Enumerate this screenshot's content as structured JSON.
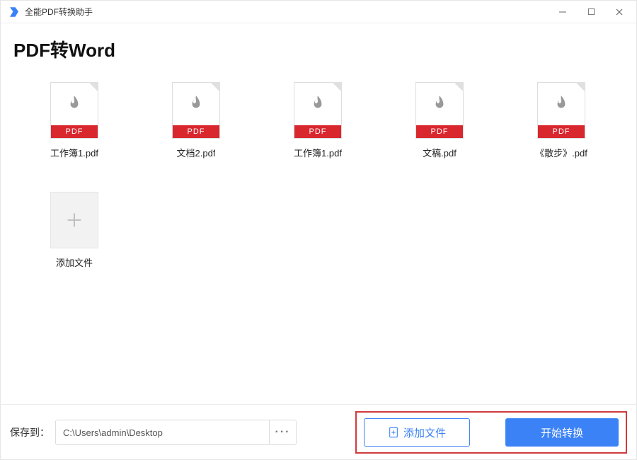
{
  "app": {
    "title": "全能PDF转换助手"
  },
  "heading": "PDF转Word",
  "pdf_badge": "PDF",
  "files": [
    {
      "name": "工作簿1.pdf"
    },
    {
      "name": "文档2.pdf"
    },
    {
      "name": "工作簿1.pdf"
    },
    {
      "name": "文稿.pdf"
    },
    {
      "name": "《散步》.pdf"
    }
  ],
  "add_tile": {
    "label": "添加文件"
  },
  "bottom": {
    "save_to_label": "保存到：",
    "path": "C:\\Users\\admin\\Desktop",
    "browse_dots": "···",
    "add_button_label": "添加文件",
    "convert_button_label": "开始转换"
  },
  "colors": {
    "accent": "#3b82f6",
    "pdf_red": "#d9272e",
    "highlight_border": "#d03a3a"
  }
}
